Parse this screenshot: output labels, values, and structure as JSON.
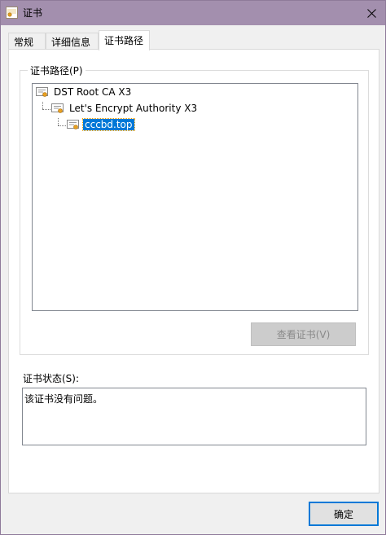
{
  "window": {
    "title": "证书",
    "close_icon": "close-icon"
  },
  "tabs": [
    {
      "label": "常规",
      "active": false
    },
    {
      "label": "详细信息",
      "active": false
    },
    {
      "label": "证书路径",
      "active": true
    }
  ],
  "cert_path": {
    "group_label": "证书路径(P)",
    "tree": [
      {
        "label": "DST Root CA X3",
        "level": 0,
        "selected": false,
        "icon": "certificate-icon"
      },
      {
        "label": "Let's Encrypt Authority X3",
        "level": 1,
        "selected": false,
        "icon": "certificate-icon"
      },
      {
        "label": "cccbd.top",
        "level": 2,
        "selected": true,
        "icon": "certificate-icon"
      }
    ],
    "view_button": "查看证书(V)"
  },
  "status": {
    "label": "证书状态(S):",
    "text": "该证书没有问题。"
  },
  "footer": {
    "ok_button": "确定"
  },
  "colors": {
    "titlebar": "#a38fae",
    "selection": "#0078d7",
    "ok_border": "#0078d7"
  }
}
